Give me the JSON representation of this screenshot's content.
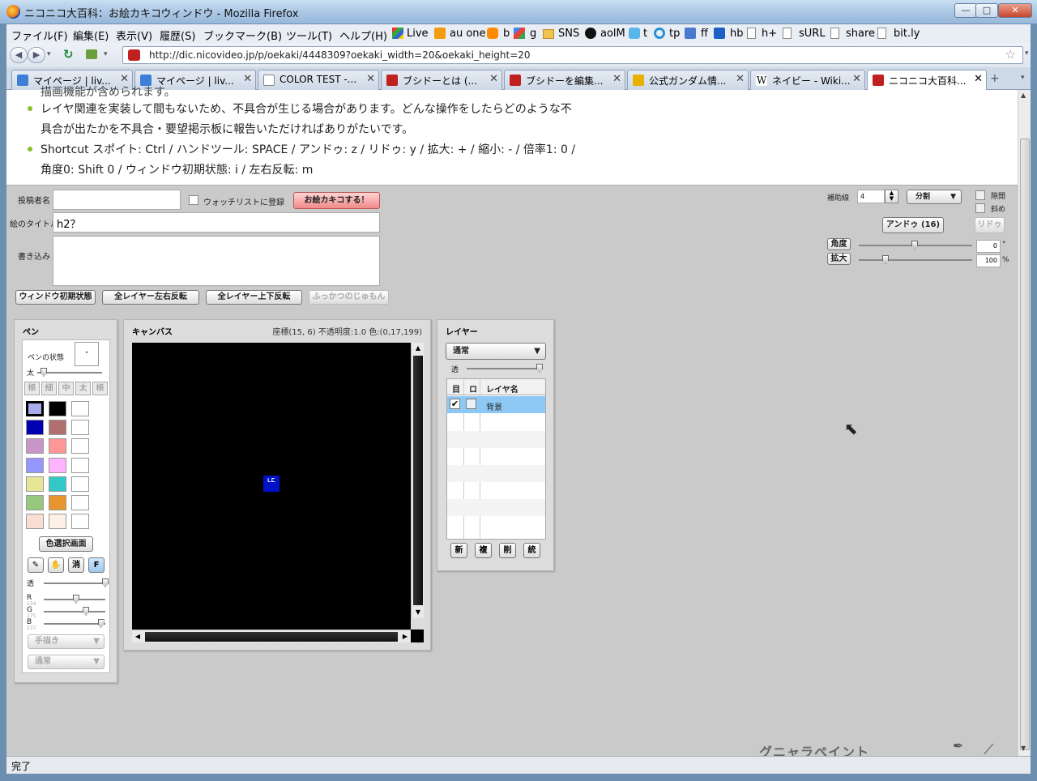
{
  "window": {
    "title": "ニコニコ大百科：お絵カキコウィンドウ - Mozilla Firefox",
    "btn_min": "—",
    "btn_max": "□",
    "btn_close": "✕"
  },
  "menu": [
    "ファイル(F)",
    "編集(E)",
    "表示(V)",
    "履歴(S)",
    "ブックマーク(B)",
    "ツール(T)",
    "ヘルプ(H)"
  ],
  "bookmarks": [
    "Live",
    "au one",
    "b",
    "g",
    "SNS",
    "aolM",
    "t",
    "tp",
    "ff",
    "hb",
    "h+",
    "sURL",
    "share",
    "bit.ly"
  ],
  "url": "http://dic.nicovideo.jp/p/oekaki/4448309?oekaki_width=20&oekaki_height=20",
  "tabs": [
    {
      "label": "マイページ | liv...",
      "color": "#3f7ed6"
    },
    {
      "label": "マイページ | liv...",
      "color": "#3f7ed6"
    },
    {
      "label": "COLOR TEST -...",
      "color": "#ffffff"
    },
    {
      "label": "ブシドーとは (...",
      "color": "#c02020"
    },
    {
      "label": "ブシドーを編集...",
      "color": "#c02020"
    },
    {
      "label": "公式ガンダム情...",
      "color": "#e8b000"
    },
    {
      "label": "ネイビー - Wiki...",
      "color": "#ffffff"
    },
    {
      "label": "ニコニコ大百科...",
      "color": "#c02020"
    }
  ],
  "notice": {
    "line0": "描画機能が含められます。",
    "line1": "レイヤ関連を実装して間もないため、不具合が生じる場合があります。どんな操作をしたらどのような不",
    "line2": "具合が出たかを不具合・要望掲示板に報告いただければありがたいです。",
    "line3": "Shortcut スポイト: Ctrl / ハンドツール: SPACE / アンドゥ: z / リドゥ: y / 拡大: + / 縮小: - / 倍率1: 0 /",
    "line4": "角度0: Shift 0 / ウィンドウ初期状態: i / 左右反転: m"
  },
  "form": {
    "author_label": "投稿者名",
    "author_value": "",
    "watchlist_label": "ウォッチリストに登録",
    "submit_label": "お絵カキコする！",
    "title_label": "絵のタイトル",
    "title_value": "h2？",
    "comment_label": "書き込み",
    "comment_value": ""
  },
  "toolbar": {
    "reset": "ウィンドウ初期状態",
    "flip_h": "全レイヤー左右反転",
    "flip_v": "全レイヤー上下反転",
    "revive": "ふっかつのじゅもん"
  },
  "guides": {
    "label": "補助線",
    "value": "4",
    "mode": "分割",
    "opt1": "隙間",
    "opt2": "斜め"
  },
  "undo": {
    "undo": "アンドゥ (16)",
    "redo": "リドゥ"
  },
  "angle": {
    "label": "角度",
    "value": "0",
    "unit": "°"
  },
  "zoom": {
    "label": "拡大",
    "value": "100",
    "unit": "%"
  },
  "pen": {
    "title": "ペン",
    "state_label": "ペンの状態",
    "thick_label": "太",
    "sizes": [
      "極",
      "細",
      "中",
      "太",
      "極"
    ],
    "colors": [
      "#aaaaee",
      "#000000",
      "#ffffff",
      "#0000b0",
      "#b07070",
      "#ffffff",
      "#c896c8",
      "#ff9696",
      "#ffffff",
      "#9696ff",
      "#ffb4ff",
      "#ffffff",
      "#e6e696",
      "#32c8c8",
      "#ffffff",
      "#96c87d",
      "#e6962d",
      "#ffffff",
      "#fadcd2",
      "#fff0e6",
      "#ffffff"
    ],
    "color_picker": "色選択画面",
    "tools": [
      "",
      "",
      "消",
      "F"
    ],
    "alpha_label": "透",
    "r_label": "R",
    "r_value": "134",
    "g_label": "G",
    "g_value": "175",
    "b_label": "B",
    "b_value": "237",
    "stroke": "手描き",
    "blend": "通常",
    "levels": {
      "alpha": 1.0,
      "r": 134,
      "g": 175,
      "b": 237,
      "thickness": 0.05
    }
  },
  "canvas": {
    "title": "キャンバス",
    "info": "座標(15, 6) 不透明度:1.0 色:(0,17,199)",
    "glyph": "ᄕ"
  },
  "layer": {
    "title": "レイヤー",
    "blend": "通常",
    "alpha_label": "透",
    "col_eye": "目",
    "col_lock": "ロ",
    "col_name": "レイヤ名",
    "rows": [
      {
        "name": "背景"
      }
    ],
    "buttons": [
      "新",
      "複",
      "削",
      "統"
    ],
    "alpha": 1.0
  },
  "brand": "グニャラペイント",
  "status": "完了"
}
